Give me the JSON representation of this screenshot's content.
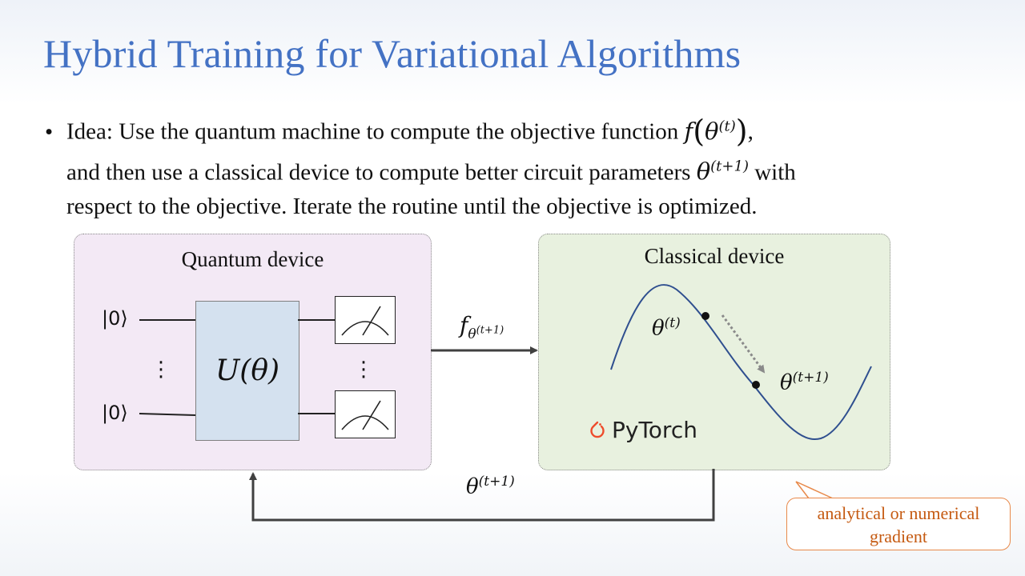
{
  "title": "Hybrid Training for Variational Algorithms",
  "bullet": {
    "line1_prefix": "Idea: Use the quantum machine to compute the objective function ",
    "line1_math": "f(θ^(t))",
    "line1_suffix": ",",
    "line2_prefix": "and then use a classical device to compute better circuit parameters ",
    "line2_math": "θ^(t+1)",
    "line2_suffix": " with",
    "line3": "respect to the objective. Iterate the routine until the objective is optimized."
  },
  "quantum_device": {
    "label": "Quantum device",
    "ket_top": "|0⟩",
    "ket_bottom": "|0⟩",
    "gate_label": "U(θ)"
  },
  "classical_device": {
    "label": "Classical device",
    "theta_t": "θ",
    "theta_t_sup": "(t)",
    "theta_t1": "θ",
    "theta_t1_sup": "(t+1)",
    "library": "PyTorch"
  },
  "arrow_forward": {
    "base": "f",
    "sub_base": "θ",
    "sub_sup": "(t+1)"
  },
  "arrow_back": {
    "base": "θ",
    "sup": "(t+1)"
  },
  "callout": {
    "line1": "analytical or numerical",
    "line2": "gradient"
  },
  "colors": {
    "title": "#4472c4",
    "quantum_bg": "#f3e9f5",
    "classical_bg": "#e8f1df",
    "gate_bg": "#d4e1ef",
    "curve": "#2f4f8f",
    "callout": "#c55a11",
    "pytorch": "#ee4c2c"
  }
}
